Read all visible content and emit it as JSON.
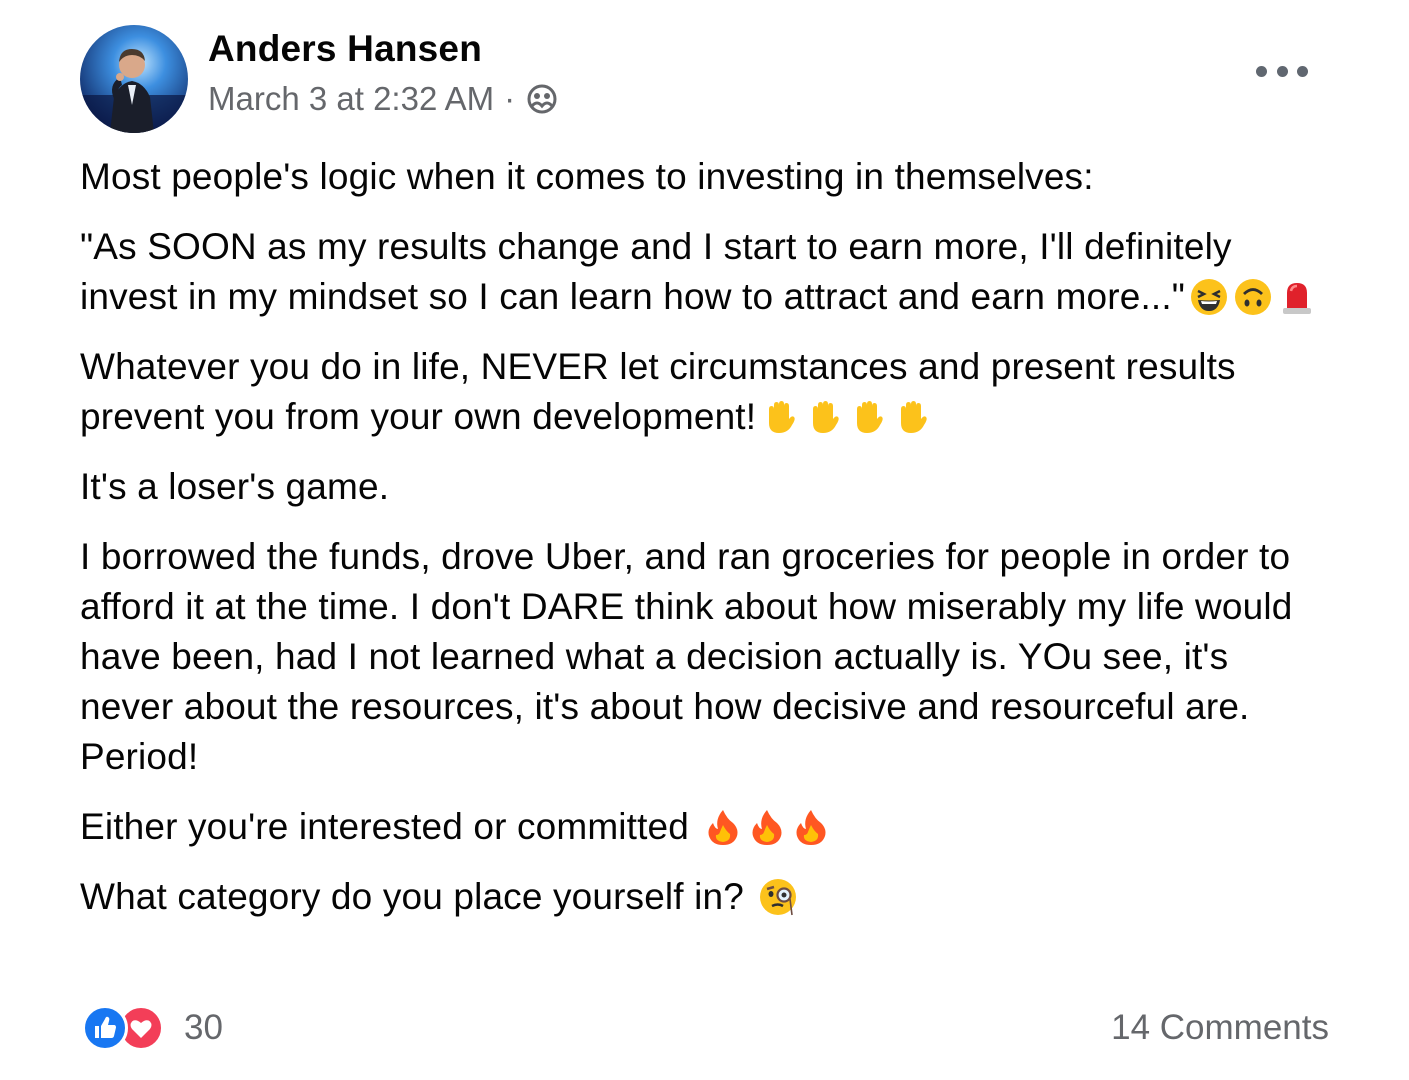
{
  "post": {
    "author": "Anders Hansen",
    "timestamp": "March 3 at 2:32 AM",
    "separator": "·",
    "privacy_icon": "friends-globe-icon",
    "more_icon": "more-options-icon",
    "paragraphs": [
      {
        "text": "Most people's logic when it comes to investing in themselves:",
        "emoji": []
      },
      {
        "text": "\"As SOON as my results change and I start to earn more, I'll definitely invest in my mindset so I can learn how to attract and earn more...\"",
        "emoji": [
          "laughing-squint",
          "upside-down-face",
          "siren"
        ]
      },
      {
        "text": "Whatever you do in life, NEVER let circumstances and present results prevent you from your own development!",
        "emoji": [
          "raised-hand",
          "raised-hand",
          "raised-hand",
          "raised-hand"
        ]
      },
      {
        "text": "It's a loser's game.",
        "emoji": []
      },
      {
        "text": "I borrowed the funds, drove Uber, and ran groceries for people in order to afford it at the time. I don't DARE think about how miserably my life would have been, had I not learned what a decision actually is. YOu see, it's never about the resources, it's about how decisive and resourceful are. Period!",
        "emoji": []
      },
      {
        "text": "Either you're interested or committed",
        "emoji": [
          "fire",
          "fire",
          "fire"
        ]
      },
      {
        "text": "What category do you place yourself in?",
        "emoji": [
          "monocle-face"
        ]
      }
    ]
  },
  "footer": {
    "reaction_icons": [
      "like-icon",
      "love-icon"
    ],
    "reaction_count": "30",
    "comments_label": "14 Comments"
  },
  "colors": {
    "like": "#1877f2",
    "love": "#f33e58",
    "secondary_text": "#65676b"
  }
}
